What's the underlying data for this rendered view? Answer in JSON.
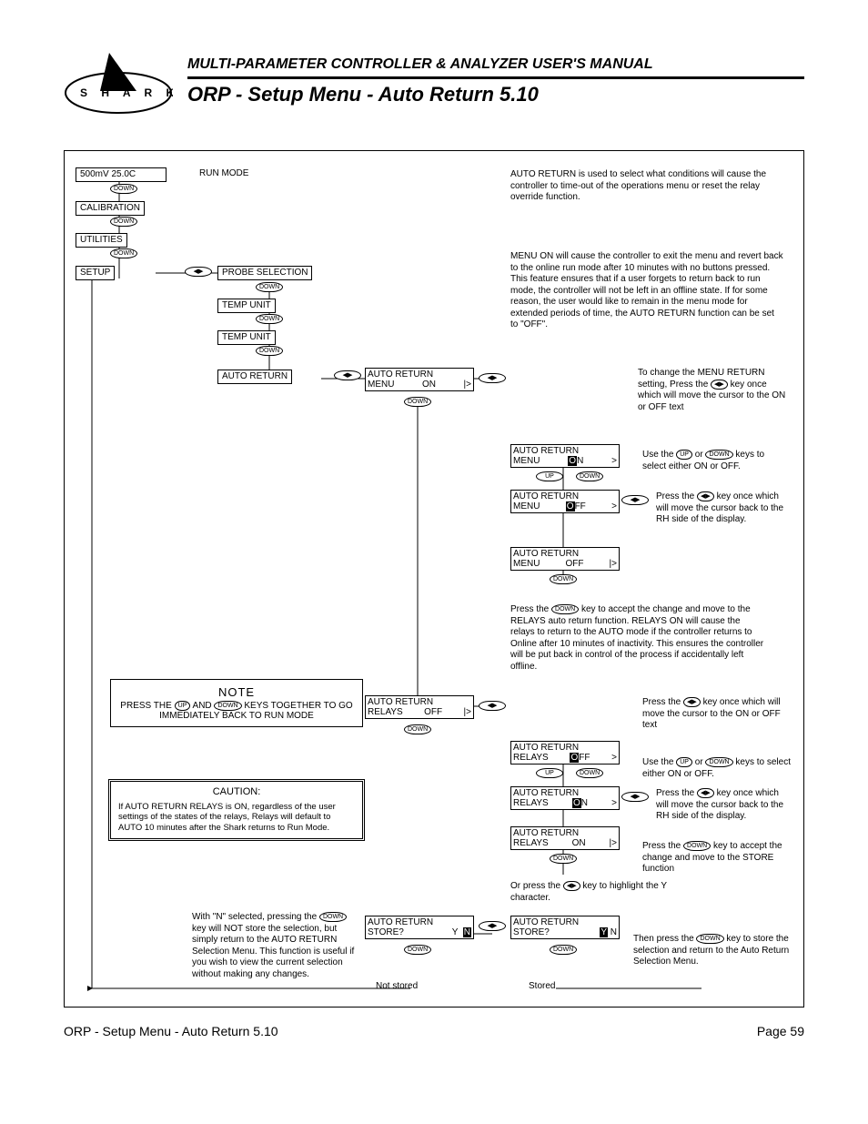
{
  "header": {
    "manual_title": "MULTI-PARAMETER CONTROLLER & ANALYZER USER'S MANUAL",
    "section_title": "ORP - Setup Menu - Auto Return 5.10",
    "logo_letters": [
      "S",
      "H",
      "A",
      "R",
      "K"
    ]
  },
  "footer": {
    "left": "ORP - Setup Menu - Auto Return 5.10",
    "right": "Page 59"
  },
  "keys": {
    "down": "DOWN",
    "up": "UP",
    "leftright": "◀▶"
  },
  "menu_path": {
    "reading": "500mV  25.0C",
    "run_mode": "RUN MODE",
    "calibration": "CALIBRATION",
    "utilities": "UTILITIES",
    "setup": "SETUP",
    "probe_selection": "PROBE SELECTION",
    "temp_unit1": "TEMP UNIT",
    "temp_unit2": "TEMP UNIT",
    "auto_return": "AUTO RETURN"
  },
  "displays": {
    "ar_menu_on": {
      "l1": "AUTO RETURN",
      "l2a": "MENU",
      "l2b": "ON",
      "cursor": "|>"
    },
    "ar_menu_on_hl": {
      "l1": "AUTO RETURN",
      "l2a": "MENU",
      "l2b": "ON",
      "hl": "O",
      "rest": "N",
      "cursor": ">"
    },
    "ar_menu_off_hl": {
      "l1": "AUTO RETURN",
      "l2a": "MENU",
      "l2b": "OFF",
      "hl": "O",
      "rest": "FF",
      "cursor": ">"
    },
    "ar_menu_off": {
      "l1": "AUTO RETURN",
      "l2a": "MENU",
      "l2b": "OFF",
      "cursor": "|>"
    },
    "ar_relays_off": {
      "l1": "AUTO RETURN",
      "l2a": "RELAYS",
      "l2b": "OFF",
      "cursor": "|>"
    },
    "ar_relays_off_hl": {
      "l1": "AUTO RETURN",
      "l2a": "RELAYS",
      "l2b": "OFF",
      "hl": "O",
      "rest": "FF",
      "cursor": ">"
    },
    "ar_relays_on_hl": {
      "l1": "AUTO RETURN",
      "l2a": "RELAYS",
      "l2b": "ON",
      "hl": "O",
      "rest": "N",
      "cursor": ">"
    },
    "ar_relays_on": {
      "l1": "AUTO RETURN",
      "l2a": "RELAYS",
      "l2b": "ON",
      "cursor": "|>"
    },
    "store_yn": {
      "l1": "AUTO RETURN",
      "l2a": "STORE?",
      "l2b": "Y  N"
    },
    "store_yn_hl": {
      "l1": "AUTO RETURN",
      "l2a": "STORE?",
      "l2b_pre": "",
      "hl": "Y",
      "l2b_post": "  N"
    }
  },
  "text": {
    "intro1": "AUTO RETURN is used to select what conditions will cause the controller to time-out of the operations menu or reset the relay override function.",
    "intro2": "MENU ON will cause the controller to exit the menu and revert back to the online run mode after 10 minutes with no buttons pressed. This feature ensures that if a user forgets to return back to run mode, the controller will not be left in an offline state. If for some reason, the user would like to remain in the menu mode for extended periods of time, the AUTO RETURN function can be set to \"OFF\".",
    "menu_change_pre": "To change the MENU RETURN setting,\nPress the ",
    "menu_change_post": " key once which will move the cursor to the ON or OFF text",
    "use_updown_pre": "Use the ",
    "use_updown_mid": " or ",
    "use_updown_post": " keys to select either ON or OFF.",
    "press_lr_back_pre": "Press the ",
    "press_lr_back_post": " key once which will move the cursor back to the RH side of the display.",
    "accept_relays_pre": "Press the ",
    "accept_relays_post": " key to accept the change and move to the RELAYS auto return function. RELAYS ON will cause the relays to return to the AUTO mode if the controller returns to Online after 10 minutes of inactivity. This ensures the controller will be put back in control of the process if accidentally left offline.",
    "relays_lr_pre": "Press the ",
    "relays_lr_post": " key once which will move the cursor to the ON or OFF text",
    "relays_updown_pre": "Use the ",
    "relays_updown_mid": " or ",
    "relays_updown_post": " keys to select either ON or OFF.",
    "relays_back_pre": "Press the ",
    "relays_back_post": " key once which will move the cursor back to the RH side of the display.",
    "to_store_pre": "Press the ",
    "to_store_post": " key to accept the change and move to the STORE function",
    "or_press_pre": "Or press the ",
    "or_press_post": " key to highlight the Y character.",
    "then_store_pre": "Then press the ",
    "then_store_post": " key to store the selection and return to the Auto Return Selection Menu.",
    "n_explain_pre": "With \"N\" selected, pressing the ",
    "n_explain_post": " key will NOT store the selection, but simply return to the AUTO RETURN Selection Menu. This function is useful if you wish to view the current selection without making any changes.",
    "not_stored": "Not stored",
    "stored": "Stored",
    "note_title": "NOTE",
    "note_body_pre": "PRESS THE ",
    "note_body_mid": " AND ",
    "note_body_post": " KEYS TOGETHER TO GO IMMEDIATELY BACK TO RUN MODE",
    "caution_title": "CAUTION:",
    "caution_body": "If AUTO RETURN RELAYS is ON, regardless of the user settings of the states of the relays, Relays will default to AUTO 10 minutes after the Shark returns to Run Mode."
  }
}
